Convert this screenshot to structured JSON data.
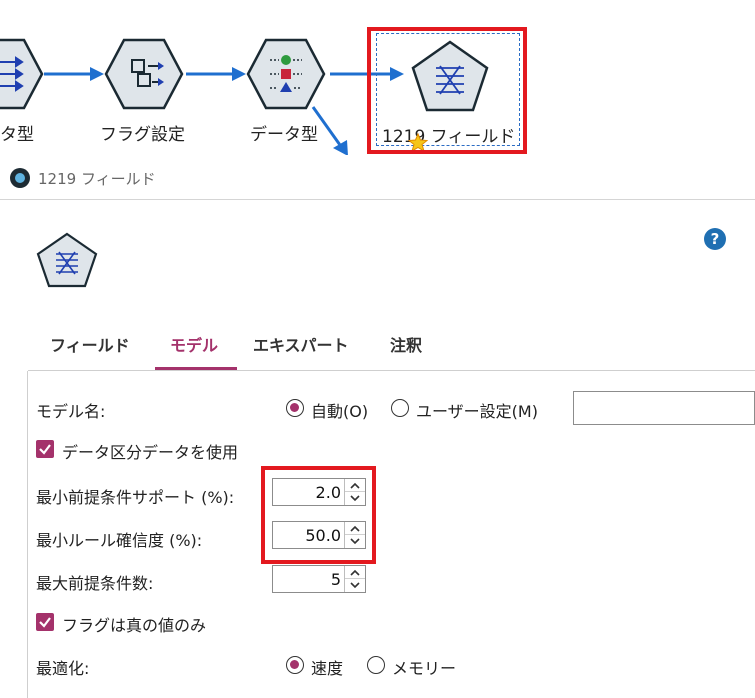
{
  "canvas": {
    "nodes": [
      {
        "label": "タ型"
      },
      {
        "label": "フラグ設定"
      },
      {
        "label": "データ型"
      },
      {
        "label": "1219 フィールド"
      }
    ]
  },
  "dialog": {
    "title": "1219 フィールド",
    "help_label": "?",
    "tabs": [
      {
        "label": "フィールド"
      },
      {
        "label": "モデル",
        "active": true
      },
      {
        "label": "エキスパート"
      },
      {
        "label": "注釈"
      }
    ],
    "model_name": {
      "label": "モデル名:",
      "auto_label": "自動(O)",
      "custom_label": "ユーザー設定(M)",
      "selected": "auto",
      "custom_value": ""
    },
    "use_partition": {
      "label": "データ区分データを使用",
      "checked": true
    },
    "min_antecedent_support": {
      "label": "最小前提条件サポート (%):",
      "value": "2.0"
    },
    "min_rule_confidence": {
      "label": "最小ルール確信度 (%):",
      "value": "50.0"
    },
    "max_antecedents": {
      "label": "最大前提条件数:",
      "value": "5"
    },
    "true_flags_only": {
      "label": "フラグは真の値のみ",
      "checked": true
    },
    "optimize": {
      "label": "最適化:",
      "speed_label": "速度",
      "memory_label": "メモリー",
      "selected": "speed"
    }
  },
  "colors": {
    "accent": "#a4326b",
    "highlight": "#e3191f",
    "node_fill": "#dfe5ea",
    "node_stroke": "#1b2a33",
    "arrow": "#1f6fcf"
  }
}
